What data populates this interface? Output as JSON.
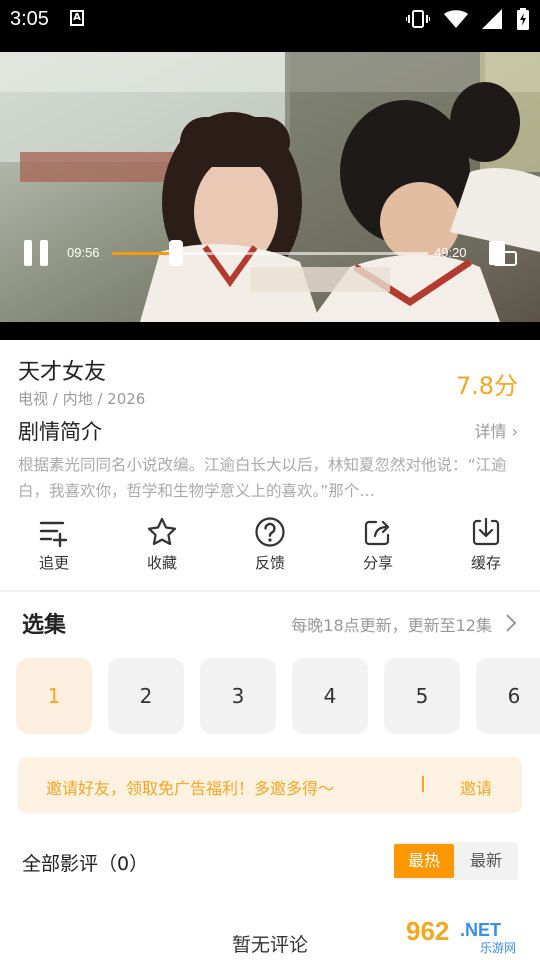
{
  "status_bar": {
    "time": "3:05",
    "a_icon": "A"
  },
  "player": {
    "current_time": "09:56",
    "total_time": "49:20",
    "progress": 0.201
  },
  "show": {
    "title": "天才女友",
    "meta": "电视 / 内地 / 2026",
    "score": "7.8分"
  },
  "synopsis": {
    "heading": "剧情简介",
    "detail_label": "详情",
    "text": "根据素光同同名小说改编。江逾白长大以后，林知夏忽然对他说：“江逾白，我喜欢你，哲学和生物学意义上的喜欢。”那个…"
  },
  "actions": [
    {
      "label": "追更",
      "icon": "add-list-icon"
    },
    {
      "label": "收藏",
      "icon": "star-icon"
    },
    {
      "label": "反馈",
      "icon": "question-icon"
    },
    {
      "label": "分享",
      "icon": "share-icon"
    },
    {
      "label": "缓存",
      "icon": "download-icon"
    }
  ],
  "episodes": {
    "heading": "选集",
    "info": "每晚18点更新，更新至12集",
    "items": [
      "1",
      "2",
      "3",
      "4",
      "5",
      "6"
    ],
    "selected": "1"
  },
  "invite": {
    "text": "邀请好友，领取免广告福利！多邀多得～",
    "button": "邀请"
  },
  "reviews": {
    "heading": "全部影评（0）",
    "sort_hot": "最热",
    "sort_new": "最新",
    "empty": "暂无评论"
  },
  "watermark": {
    "text": "962.NET",
    "subtext": "乐游网"
  },
  "colors": {
    "accent": "#f5a623",
    "hot_button": "#ff9800"
  }
}
